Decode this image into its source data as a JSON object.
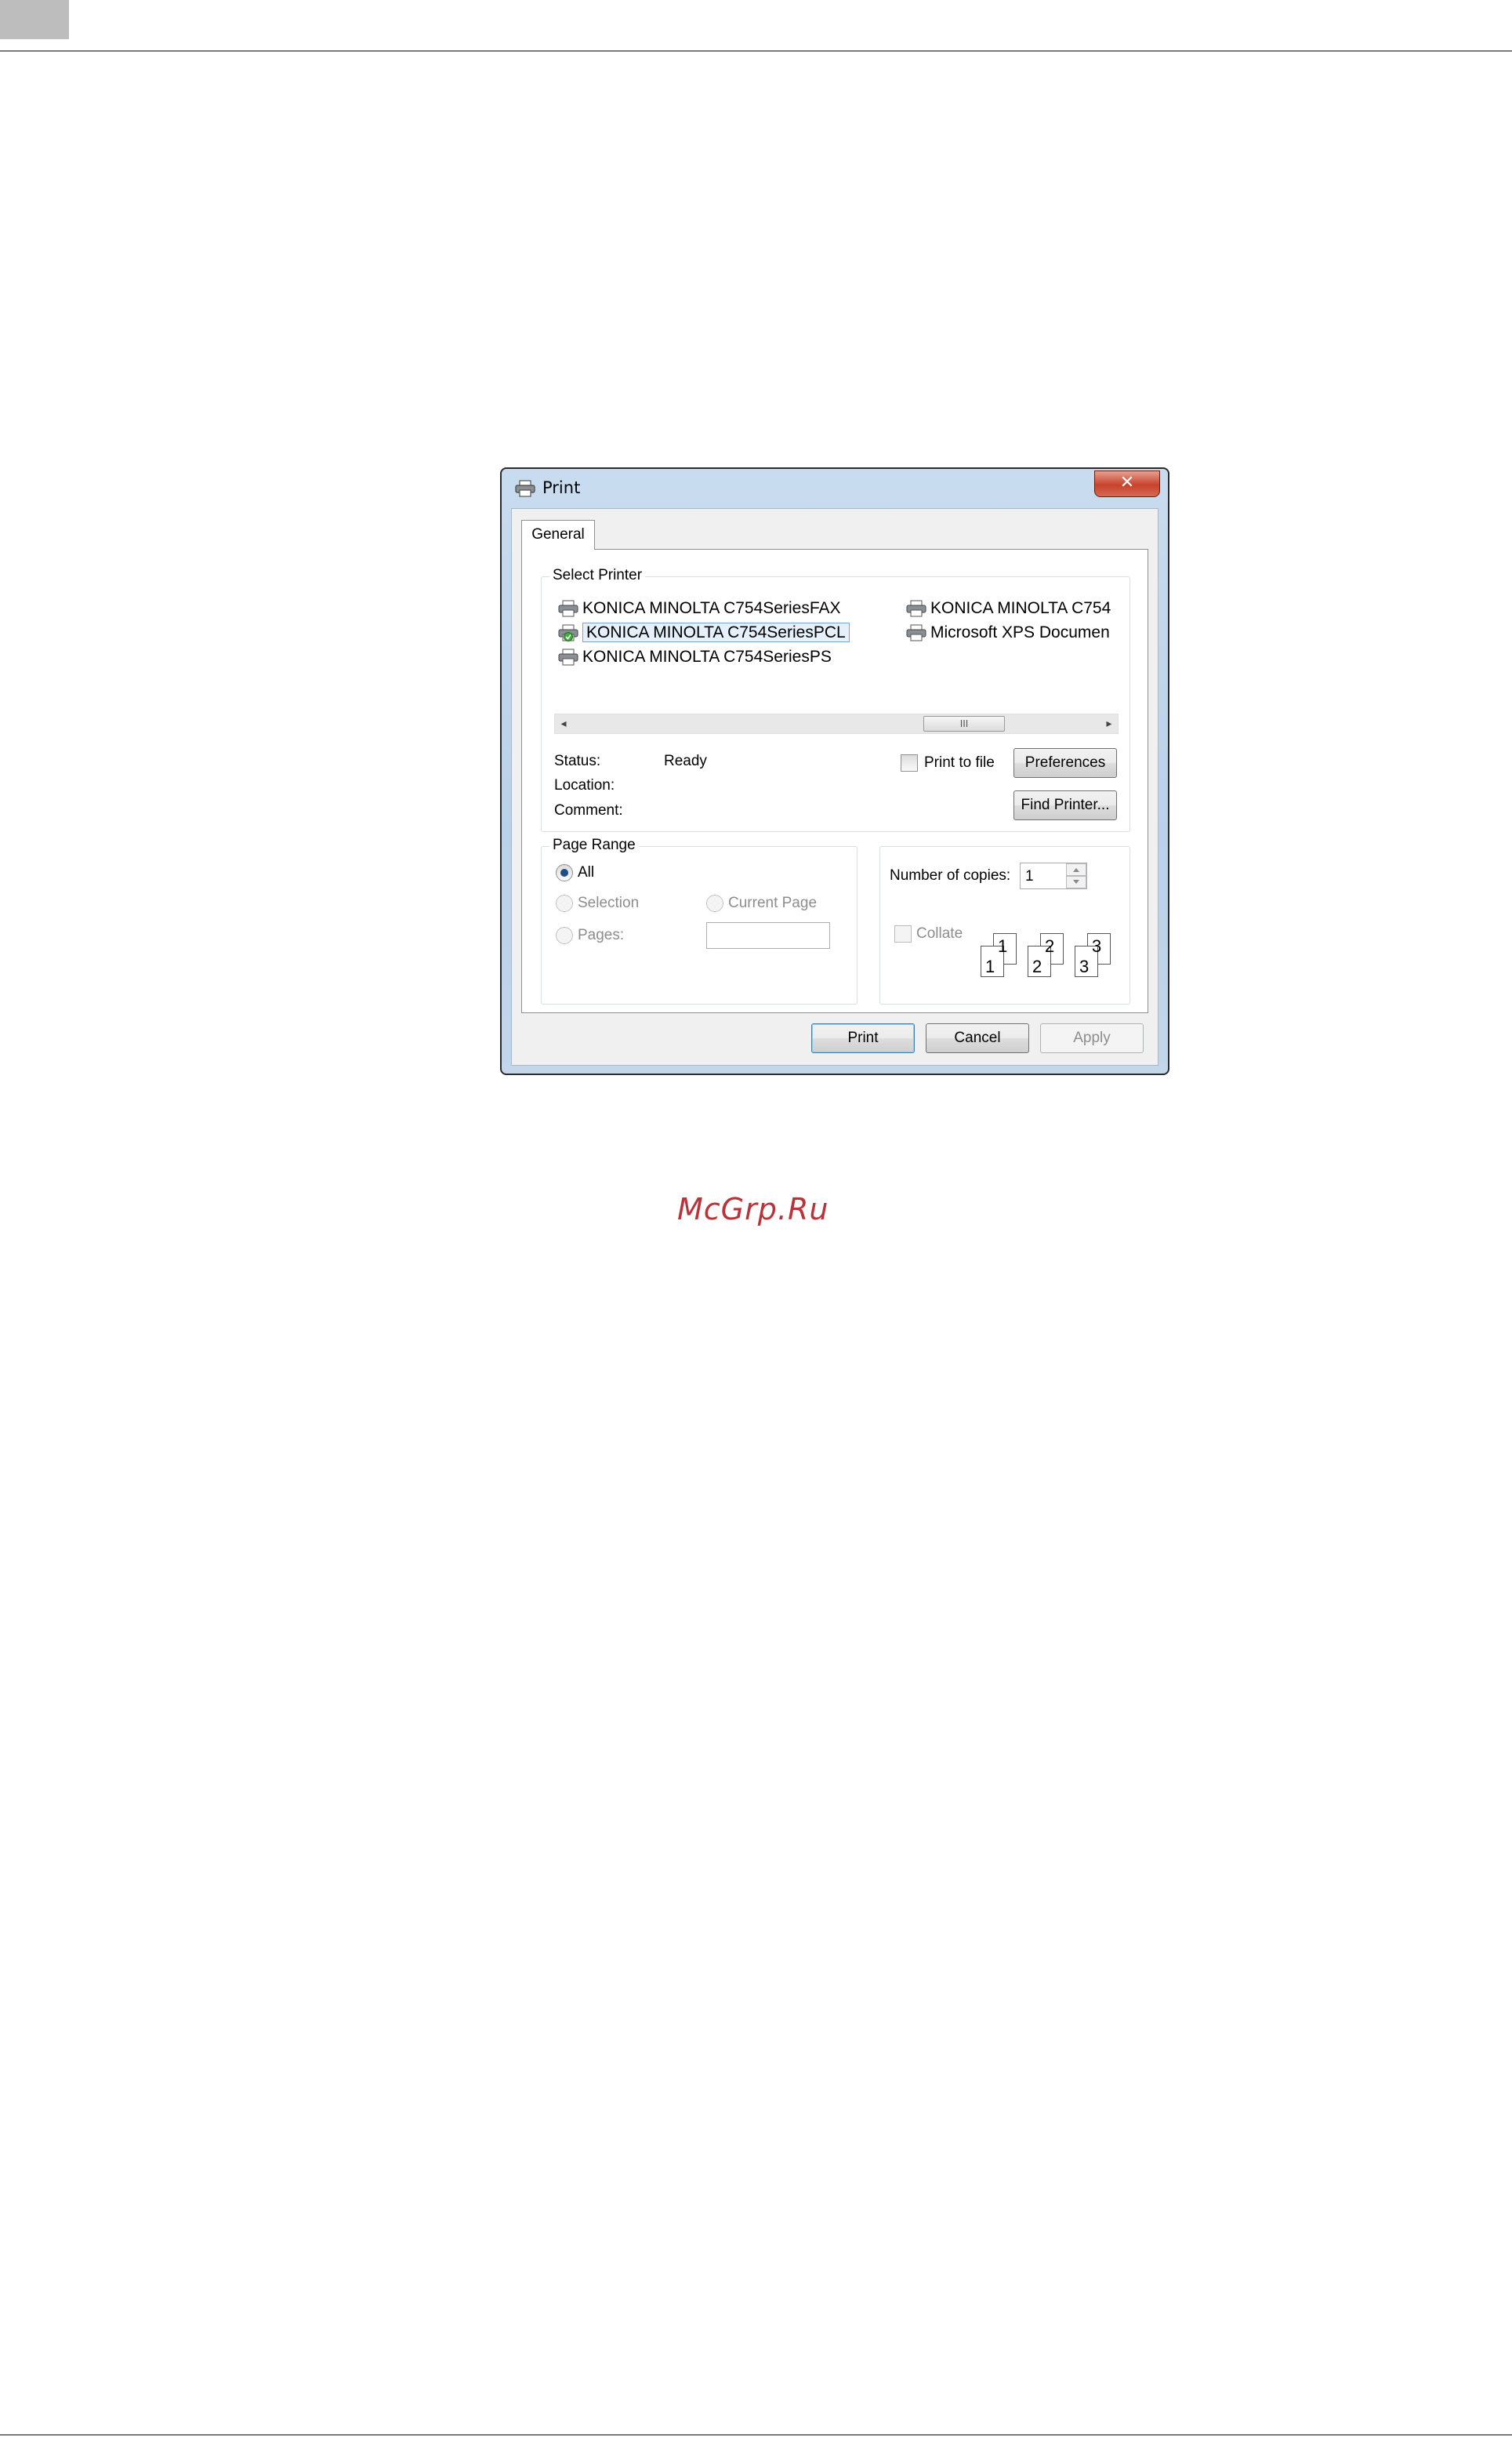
{
  "dialog": {
    "title": "Print",
    "close_glyph": "✕",
    "tab_label": "General",
    "colors": {
      "frame": "#b9d1ea",
      "close": "#c7422b",
      "selection": "#e5f0fb"
    }
  },
  "select_printer": {
    "label": "Select Printer",
    "printers": [
      {
        "name": "KONICA MINOLTA C754SeriesFAX",
        "icon": "printer-icon"
      },
      {
        "name": "KONICA MINOLTA C754SeriesPCL",
        "icon": "printer-default-icon",
        "selected": true
      },
      {
        "name": "KONICA MINOLTA C754SeriesPS",
        "icon": "printer-icon"
      },
      {
        "name": "KONICA MINOLTA C754",
        "icon": "printer-icon"
      },
      {
        "name": "Microsoft XPS Documen",
        "icon": "printer-icon"
      }
    ],
    "scroll_left": "◂",
    "scroll_right": "▸",
    "scroll_grip": "III",
    "status_label": "Status:",
    "status_value": "Ready",
    "location_label": "Location:",
    "comment_label": "Comment:",
    "print_to_file_label": "Print to file",
    "preferences_label": "Preferences",
    "find_printer_label": "Find Printer..."
  },
  "page_range": {
    "label": "Page Range",
    "all_label": "All",
    "selection_label": "Selection",
    "current_page_label": "Current Page",
    "pages_label": "Pages:",
    "pages_value": ""
  },
  "copies": {
    "label": "Number of copies:",
    "value": "1",
    "collate_label": "Collate",
    "collate_numbers": [
      "1",
      "1",
      "2",
      "2",
      "3",
      "3"
    ]
  },
  "buttons": {
    "print": "Print",
    "cancel": "Cancel",
    "apply": "Apply"
  },
  "watermark": "McGrp.Ru"
}
